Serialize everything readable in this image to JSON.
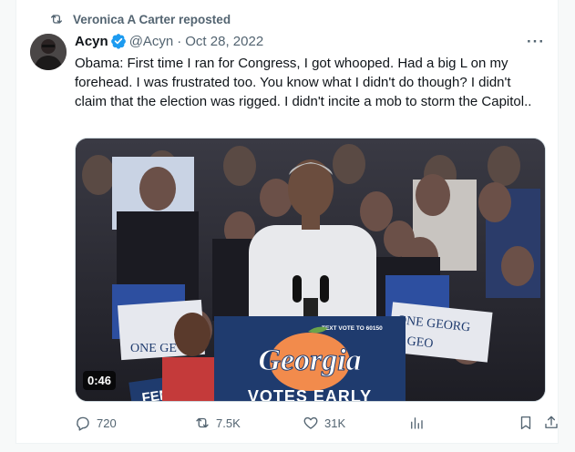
{
  "repost": {
    "text": "Veronica A Carter reposted",
    "icon": "repost-icon"
  },
  "author": {
    "name": "Acyn",
    "verified": true,
    "handle": "@Acyn",
    "separator": "·",
    "date": "Oct 28, 2022",
    "avatar": "avatar"
  },
  "tweet": {
    "text": "Obama: First time I ran for Congress, I got whooped. Had a big L on my forehead. I was frustrated too. You know what I didn't do though? I didn't claim that the election was rigged. I didn't incite a mob to storm the Capitol.."
  },
  "media": {
    "duration": "0:46",
    "sign_small": "TEXT VOTE TO 60150",
    "sign_main": "Georgia",
    "sign_bottom": "VOTES EARLY",
    "crowd_sign_left": "ONE GE",
    "crowd_sign_right_1": "ONE GEORG",
    "crowd_sign_right_2": "GEO",
    "crowd_sign_bottom": "FEND",
    "colors": {
      "navy": "#1f3b6e",
      "peach": "#f28b4c"
    }
  },
  "actions": {
    "replies": "720",
    "reposts": "7.5K",
    "likes": "31K"
  },
  "colors": {
    "text": "#0f1419",
    "secondary": "#536471",
    "verified": "#1d9bf0"
  }
}
